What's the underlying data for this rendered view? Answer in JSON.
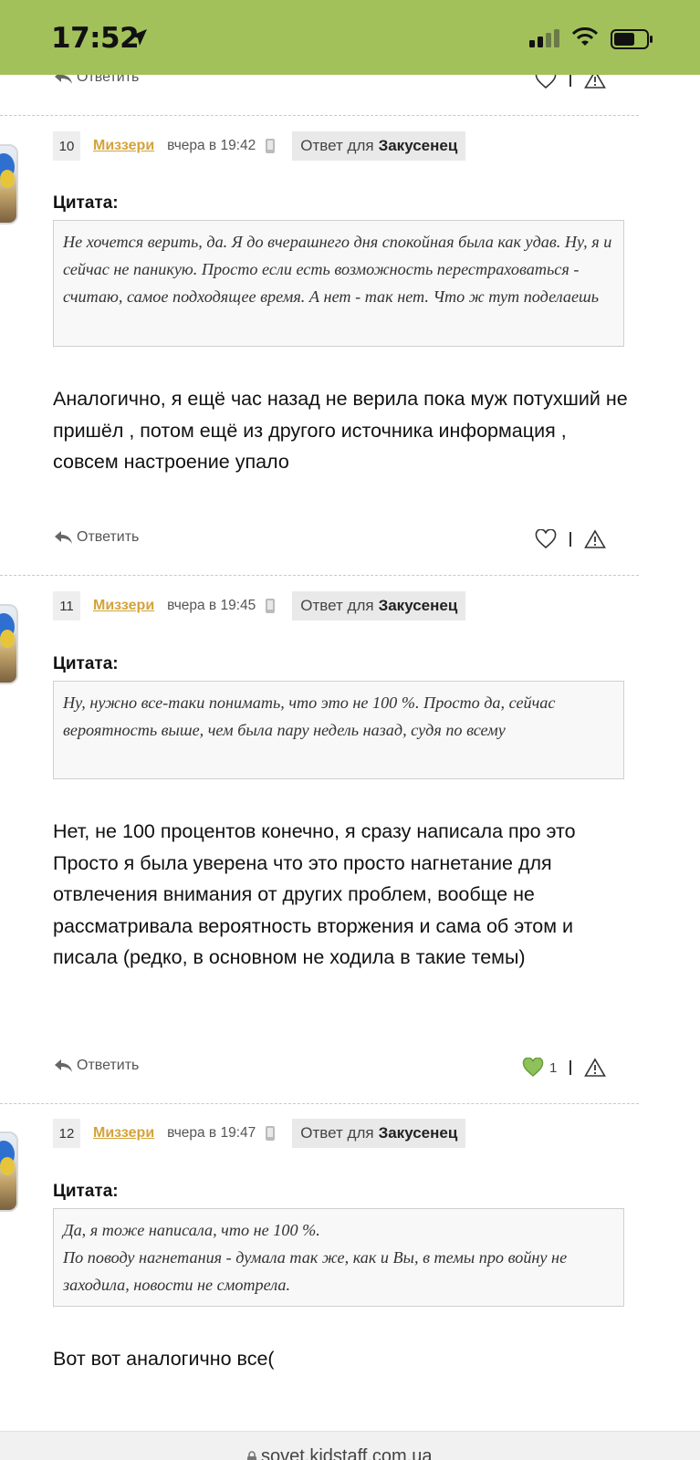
{
  "status_bar": {
    "time": "17:52",
    "colors": {
      "background": "#a3c15b"
    }
  },
  "top_post": {
    "reply_label": "Ответить"
  },
  "posts": [
    {
      "number": "10",
      "author": "Миззери",
      "time": "вчера в 19:42",
      "answer_prefix": "Ответ для",
      "answer_to": "Закусенец",
      "quote_label": "Цитата:",
      "quote": "Не хочется верить, да. Я до вчерашнего дня спокойная была как удав. Ну, я и сейчас не паникую. Просто если есть возможность перестраховаться - считаю, самое подходящее время. А нет - так нет. Что ж тут поделаешь",
      "text": "Аналогично, я ещё час назад не верила пока муж потухший не пришёл , потом ещё из другого источника информация , совсем настроение упало",
      "reply_label": "Ответить",
      "likes": ""
    },
    {
      "number": "11",
      "author": "Миззери",
      "time": "вчера в 19:45",
      "answer_prefix": "Ответ для",
      "answer_to": "Закусенец",
      "quote_label": "Цитата:",
      "quote": "Ну, нужно все-таки понимать, что это не 100 %. Просто да, сейчас вероятность выше, чем была пару недель назад, судя по всему",
      "text_lines": [
        "Нет, не 100 процентов конечно, я сразу написала про это",
        "Просто я была уверена что это просто нагнетание для отвлечения внимания от других проблем, вообще не рассматривала вероятность вторжения и сама об этом и писала (редко, в основном не ходила в такие темы)"
      ],
      "reply_label": "Ответить",
      "likes": "1"
    },
    {
      "number": "12",
      "author": "Миззери",
      "time": "вчера в 19:47",
      "answer_prefix": "Ответ для",
      "answer_to": "Закусенец",
      "quote_label": "Цитата:",
      "quote_lines": [
        "Да, я тоже написала, что не 100 %.",
        "По поводу нагнетания - думала так же, как и Вы, в темы про войну не заходила, новости не смотрела."
      ],
      "text": "Вот вот аналогично все("
    }
  ],
  "browser": {
    "url": "sovet.kidstaff.com.ua"
  },
  "icons": [
    "location-arrow-icon",
    "signal-icon",
    "wifi-icon",
    "battery-icon",
    "reply-arrow-icon",
    "heart-icon",
    "warning-icon",
    "mobile-phone-icon",
    "lock-icon"
  ],
  "colors": {
    "author": "#d4a23a",
    "liked_heart": "#8fc15a",
    "accent_bar": "#a3c15b"
  }
}
